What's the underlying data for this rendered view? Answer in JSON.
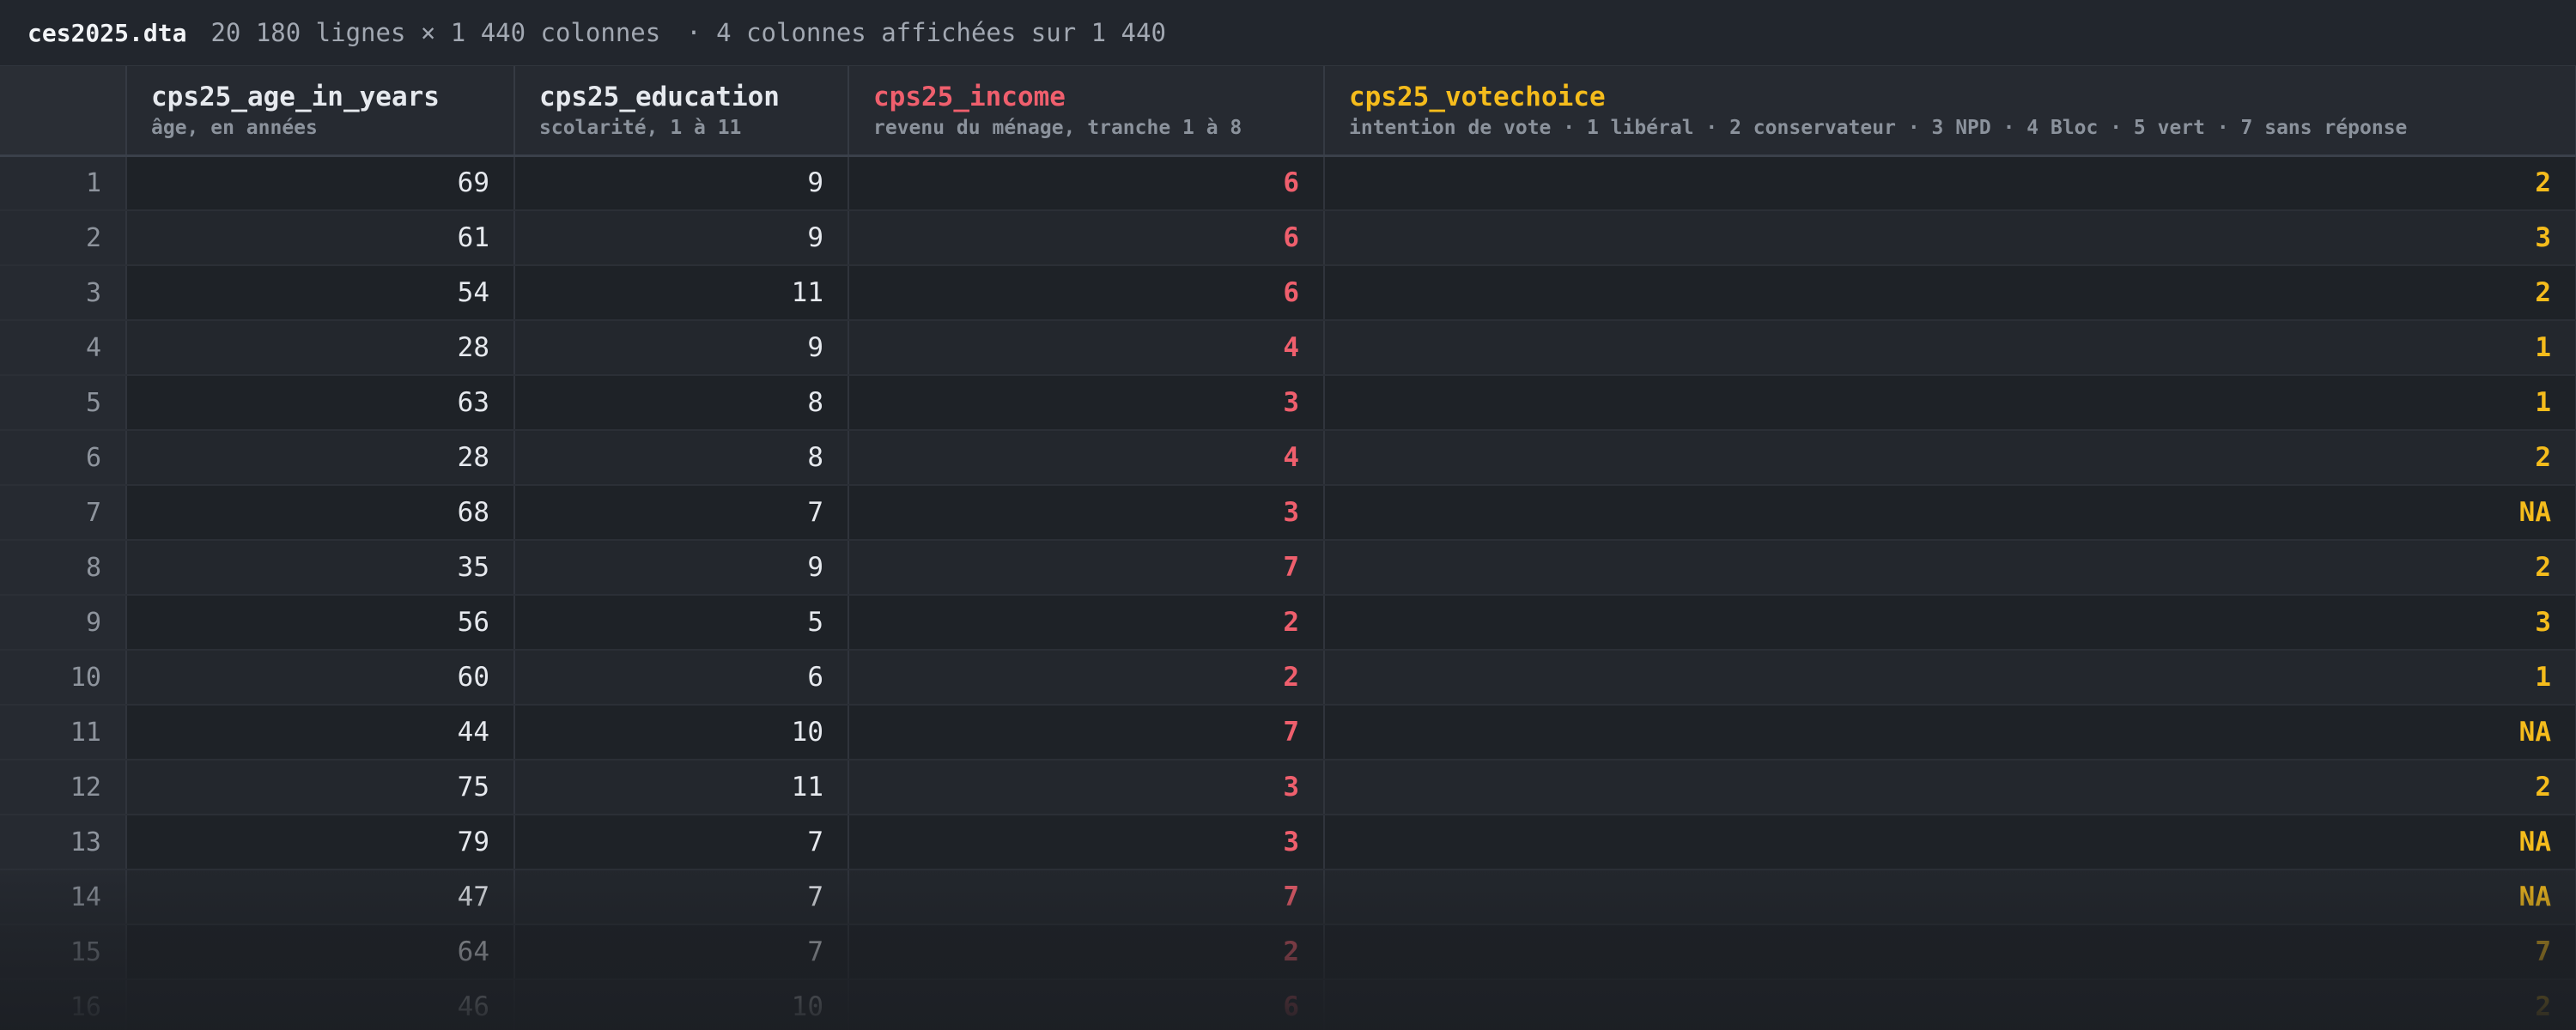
{
  "file": {
    "name": "ces2025.dta",
    "dimensions": "20 180 lignes × 1 440 colonnes",
    "columns_shown": "· 4 colonnes affichées sur 1 440"
  },
  "columns": [
    {
      "name": "cps25_age_in_years",
      "desc": "âge, en années"
    },
    {
      "name": "cps25_education",
      "desc": "scolarité, 1 à 11"
    },
    {
      "name": "cps25_income",
      "desc": "revenu du ménage, tranche 1 à 8",
      "color": "#ef5f6d"
    },
    {
      "name": "cps25_votechoice",
      "desc": "intention de vote · 1 libéral · 2 conservateur · 3 NPD · 4 Bloc · 5 vert · 7 sans réponse",
      "color": "#f5bc1c"
    }
  ],
  "rows": [
    {
      "n": "1",
      "age": "69",
      "edu": "9",
      "inc": "6",
      "vote": "2"
    },
    {
      "n": "2",
      "age": "61",
      "edu": "9",
      "inc": "6",
      "vote": "3"
    },
    {
      "n": "3",
      "age": "54",
      "edu": "11",
      "inc": "6",
      "vote": "2"
    },
    {
      "n": "4",
      "age": "28",
      "edu": "9",
      "inc": "4",
      "vote": "1"
    },
    {
      "n": "5",
      "age": "63",
      "edu": "8",
      "inc": "3",
      "vote": "1"
    },
    {
      "n": "6",
      "age": "28",
      "edu": "8",
      "inc": "4",
      "vote": "2"
    },
    {
      "n": "7",
      "age": "68",
      "edu": "7",
      "inc": "3",
      "vote": "NA"
    },
    {
      "n": "8",
      "age": "35",
      "edu": "9",
      "inc": "7",
      "vote": "2"
    },
    {
      "n": "9",
      "age": "56",
      "edu": "5",
      "inc": "2",
      "vote": "3"
    },
    {
      "n": "10",
      "age": "60",
      "edu": "6",
      "inc": "2",
      "vote": "1"
    },
    {
      "n": "11",
      "age": "44",
      "edu": "10",
      "inc": "7",
      "vote": "NA"
    },
    {
      "n": "12",
      "age": "75",
      "edu": "11",
      "inc": "3",
      "vote": "2"
    },
    {
      "n": "13",
      "age": "79",
      "edu": "7",
      "inc": "3",
      "vote": "NA"
    },
    {
      "n": "14",
      "age": "47",
      "edu": "7",
      "inc": "7",
      "vote": "NA"
    },
    {
      "n": "15",
      "age": "64",
      "edu": "7",
      "inc": "2",
      "vote": "7"
    },
    {
      "n": "16",
      "age": "46",
      "edu": "10",
      "inc": "6",
      "vote": "2"
    }
  ]
}
